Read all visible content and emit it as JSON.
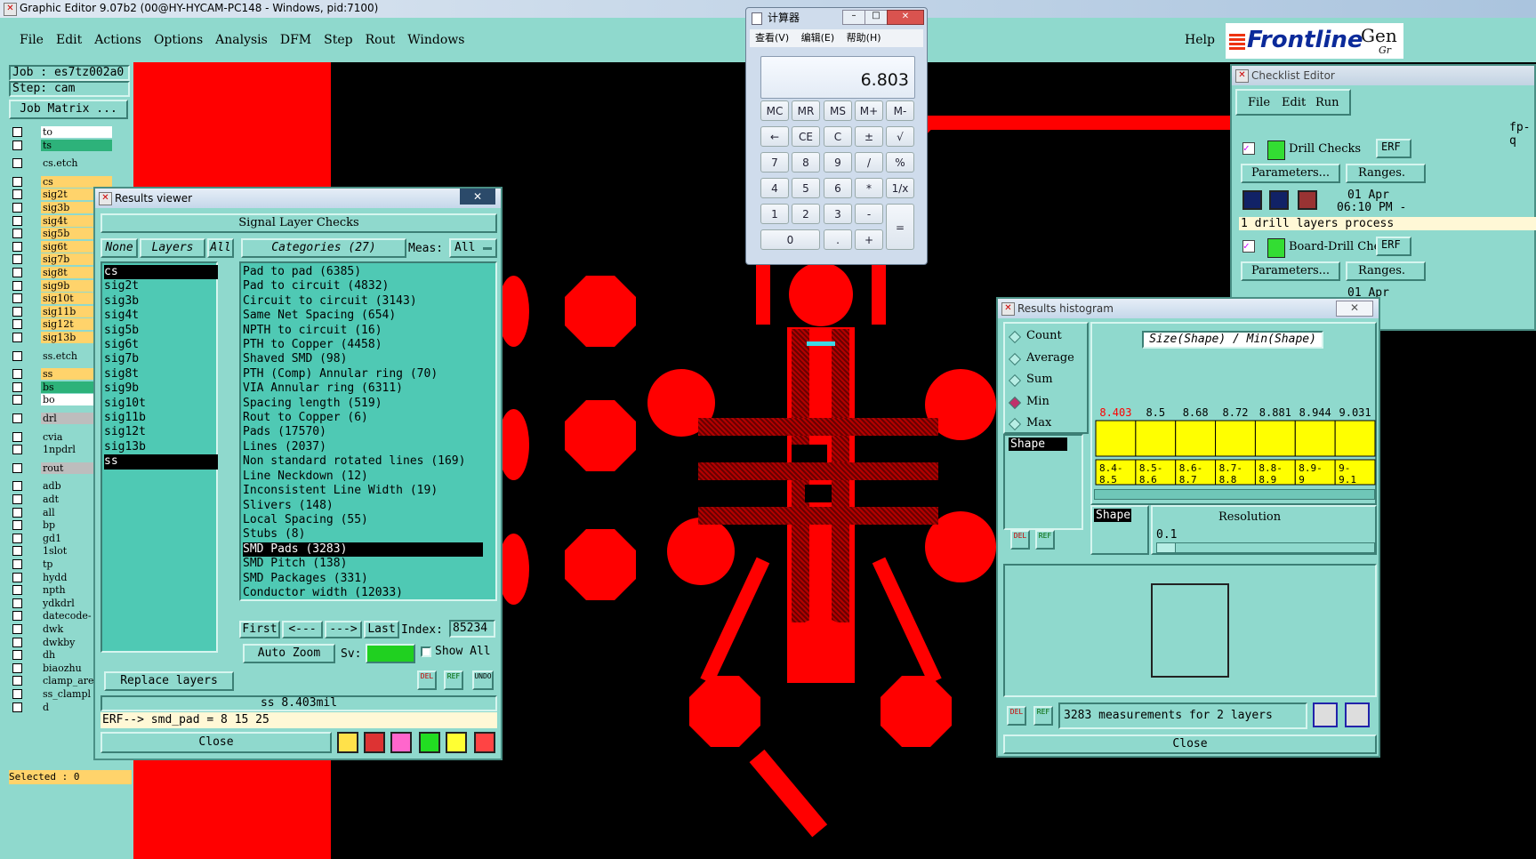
{
  "app": {
    "title": "Graphic Editor 9.07b2 (00@HY-HYCAM-PC148 - Windows, pid:7100)"
  },
  "menu": {
    "items": [
      "File",
      "Edit",
      "Actions",
      "Options",
      "Analysis",
      "DFM",
      "Step",
      "Rout",
      "Windows"
    ],
    "help": "Help"
  },
  "brand": {
    "logo": "Frontline",
    "partial": "Gen",
    "partial2": "Gr"
  },
  "job": {
    "job_label": "Job : es7tz002a0",
    "step_label": "Step: cam",
    "matrix_button": "Job Matrix ..."
  },
  "layers": [
    "to",
    "ts",
    "cs.etch",
    "cs",
    "sig2t",
    "sig3b",
    "sig4t",
    "sig5b",
    "sig6t",
    "sig7b",
    "sig8t",
    "sig9b",
    "sig10t",
    "sig11b",
    "sig12t",
    "sig13b",
    "ss.etch",
    "ss",
    "bs",
    "bo",
    "drl",
    "cvia",
    "1npdrl",
    "rout",
    "adb",
    "adt",
    "all",
    "bp",
    "gd1",
    "1slot",
    "tp",
    "hydd",
    "npth",
    "ydkdrl",
    "datecode-",
    "dwk",
    "dwkby",
    "dh",
    "biaozhu",
    "clamp_are",
    "ss_clampl",
    "d"
  ],
  "selected_label": "Selected : 0",
  "results_viewer": {
    "title": "Results viewer",
    "header": "Signal Layer Checks",
    "btn_none": "None",
    "btn_layers": "Layers",
    "btn_all": "All",
    "categories_label": "Categories (27)",
    "meas_label": "Meas:",
    "meas_value": "All",
    "layer_list": [
      "cs",
      "sig2t",
      "sig3b",
      "sig4t",
      "sig5b",
      "sig6t",
      "sig7b",
      "sig8t",
      "sig9b",
      "sig10t",
      "sig11b",
      "sig12t",
      "sig13b",
      "ss"
    ],
    "categories": [
      "Pad to pad (6385)",
      "Pad to circuit (4832)",
      "Circuit to circuit (3143)",
      "Same Net Spacing (654)",
      "NPTH to circuit (16)",
      "PTH to Copper (4458)",
      "Shaved SMD (98)",
      "PTH (Comp) Annular ring (70)",
      "VIA Annular ring (6311)",
      "Spacing length (519)",
      "Rout to Copper (6)",
      "Pads (17570)",
      "Lines (2037)",
      "Non standard rotated lines (169)",
      "Line Neckdown (12)",
      "Inconsistent Line Width (19)",
      "Slivers (148)",
      "Local Spacing (55)",
      "Stubs (8)",
      "SMD Pads (3283)",
      "SMD Pitch (138)",
      "SMD Packages (331)",
      "Conductor width (12033)"
    ],
    "selected_category": "SMD Pads (3283)",
    "nav_first": "First",
    "nav_prev": "<---",
    "nav_next": "--->",
    "nav_last": "Last",
    "index_label": "Index:",
    "index_value": "85234",
    "auto_zoom": "Auto Zoom",
    "sv_label": "Sv:",
    "show_all": "Show All",
    "replace_layers": "Replace layers",
    "status": "ss 8.403mil",
    "erf": "ERF--> smd_pad = 8 15 25",
    "close": "Close",
    "del": "DEL",
    "ref": "REF",
    "undo": "UNDO"
  },
  "calculator": {
    "title": "计算器",
    "menu": [
      "查看(V)",
      "编辑(E)",
      "帮助(H)"
    ],
    "display": "6.803",
    "keys": [
      [
        "MC",
        "MR",
        "MS",
        "M+",
        "M-"
      ],
      [
        "←",
        "CE",
        "C",
        "±",
        "√"
      ],
      [
        "7",
        "8",
        "9",
        "/",
        "%"
      ],
      [
        "4",
        "5",
        "6",
        "*",
        "1/x"
      ],
      [
        "1",
        "2",
        "3",
        "-",
        "="
      ],
      [
        "0",
        ".",
        "+"
      ]
    ]
  },
  "histogram": {
    "title": "Results histogram",
    "modes": [
      "Count",
      "Average",
      "Sum",
      "Min",
      "Max"
    ],
    "active_mode": "Min",
    "chart_title": "Size(Shape) / Min(Shape)",
    "list_item": "Shape",
    "sort_label": "Shape",
    "resolution_label": "Resolution",
    "resolution_value": "0.1",
    "summary": "3283 measurements for 2 layers",
    "close": "Close",
    "colors": {
      "bar_fill": "#ffff00",
      "first_value": "#ff0000"
    }
  },
  "chart_data": {
    "type": "bar",
    "title": "Size(Shape) / Min(Shape)",
    "categories": [
      "8.4-8.5",
      "8.5-8.6",
      "8.6-8.7",
      "8.7-8.8",
      "8.8-8.9",
      "8.9-9",
      "9-9.1"
    ],
    "values": [
      8.403,
      8.5,
      8.68,
      8.72,
      8.881,
      8.944,
      9.031
    ],
    "value_labels": [
      "8.403",
      "8.5",
      "8.68",
      "8.72",
      "8.881",
      "8.944",
      "9.031"
    ]
  },
  "checklist": {
    "title": "Checklist Editor",
    "menu": [
      "File",
      "Edit",
      "Run"
    ],
    "name_partial": "fp-q",
    "items": [
      {
        "name": "Drill Checks",
        "erf": "ERF",
        "params": "Parameters...",
        "ranges": "Ranges.",
        "date": "01 Apr",
        "time": "06:10 PM -",
        "status": "1 drill layers process"
      },
      {
        "name": "Board-Drill Che",
        "erf": "ERF",
        "params": "Parameters...",
        "ranges": "Ranges.",
        "date": "01 Apr"
      }
    ]
  }
}
